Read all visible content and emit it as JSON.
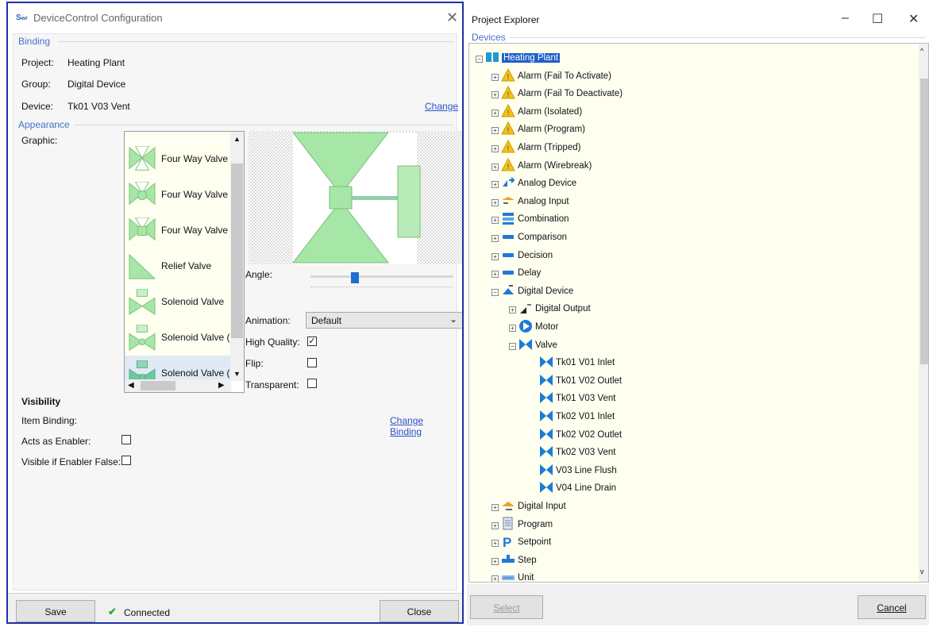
{
  "dialog": {
    "title": "DeviceControl Configuration",
    "app_icon": "swr-app-icon",
    "binding": {
      "section": "Binding",
      "project_label": "Project:",
      "project": "Heating Plant",
      "group_label": "Group:",
      "group": "Digital Device",
      "device_label": "Device:",
      "device": "Tk01 V03 Vent",
      "change_link": "Change"
    },
    "appearance": {
      "section": "Appearance",
      "graphic_label": "Graphic:",
      "graphics": [
        "Four Way Valve",
        "Four Way Valve (",
        "Four Way Valve (",
        "Relief Valve",
        "Solenoid Valve",
        "Solenoid Valve (C",
        "Solenoid Valve (S"
      ],
      "angle_label": "Angle:",
      "angle_value_fraction": 0.3,
      "animation_label": "Animation:",
      "animation_value": "Default",
      "high_quality_label": "High Quality:",
      "high_quality": true,
      "flip_label": "Flip:",
      "flip": false,
      "transparent_label": "Transparent:",
      "transparent": false
    },
    "visibility": {
      "section": "Visibility",
      "item_binding_label": "Item Binding:",
      "change_binding_link": "Change Binding",
      "acts_as_enabler_label": "Acts as Enabler:",
      "acts_as_enabler": false,
      "visible_if_false_label": "Visible if Enabler False:",
      "visible_if_false": false
    },
    "footer": {
      "save": "Save",
      "status": "Connected",
      "close": "Close"
    },
    "colors": {
      "valve_fill": "#a6e6a6",
      "valve_stroke": "#7cbf7c",
      "accent": "#2b52c9",
      "border": "#2130a8"
    }
  },
  "explorer": {
    "title": "Project Explorer",
    "controls": {
      "minimize": "–",
      "maximize": "☐",
      "close": "✕"
    },
    "tab": "Devices",
    "root": "Heating Plant",
    "nodes": [
      {
        "label": "Alarm (Fail To Activate)",
        "icon": "warning-icon"
      },
      {
        "label": "Alarm (Fail To Deactivate)",
        "icon": "warning-icon"
      },
      {
        "label": "Alarm (Isolated)",
        "icon": "warning-icon"
      },
      {
        "label": "Alarm (Program)",
        "icon": "warning-icon"
      },
      {
        "label": "Alarm (Tripped)",
        "icon": "warning-icon"
      },
      {
        "label": "Alarm (Wirebreak)",
        "icon": "warning-icon"
      },
      {
        "label": "Analog Device",
        "icon": "analog-device-icon"
      },
      {
        "label": "Analog Input",
        "icon": "analog-input-icon"
      },
      {
        "label": "Combination",
        "icon": "combination-icon"
      },
      {
        "label": "Comparison",
        "icon": "comparison-icon"
      },
      {
        "label": "Decision",
        "icon": "decision-icon"
      },
      {
        "label": "Delay",
        "icon": "delay-icon"
      },
      {
        "label": "Digital Device",
        "icon": "digital-device-icon"
      }
    ],
    "digital_children": [
      {
        "label": "Digital Output",
        "icon": "digital-output-icon"
      },
      {
        "label": "Motor",
        "icon": "motor-icon"
      },
      {
        "label": "Valve",
        "icon": "valve-icon"
      }
    ],
    "valves": [
      "Tk01 V01 Inlet",
      "Tk01 V02 Outlet",
      "Tk01 V03 Vent",
      "Tk02 V01 Inlet",
      "Tk02 V02 Outlet",
      "Tk02 V03 Vent",
      "V03 Line Flush",
      "V04 Line Drain"
    ],
    "tail_nodes": [
      {
        "label": "Digital Input",
        "icon": "digital-input-icon"
      },
      {
        "label": "Program",
        "icon": "program-icon"
      },
      {
        "label": "Setpoint",
        "icon": "setpoint-icon"
      },
      {
        "label": "Step",
        "icon": "step-icon"
      },
      {
        "label": "Unit",
        "icon": "unit-icon"
      }
    ],
    "footer": {
      "select": "Select",
      "cancel": "Cancel"
    }
  }
}
